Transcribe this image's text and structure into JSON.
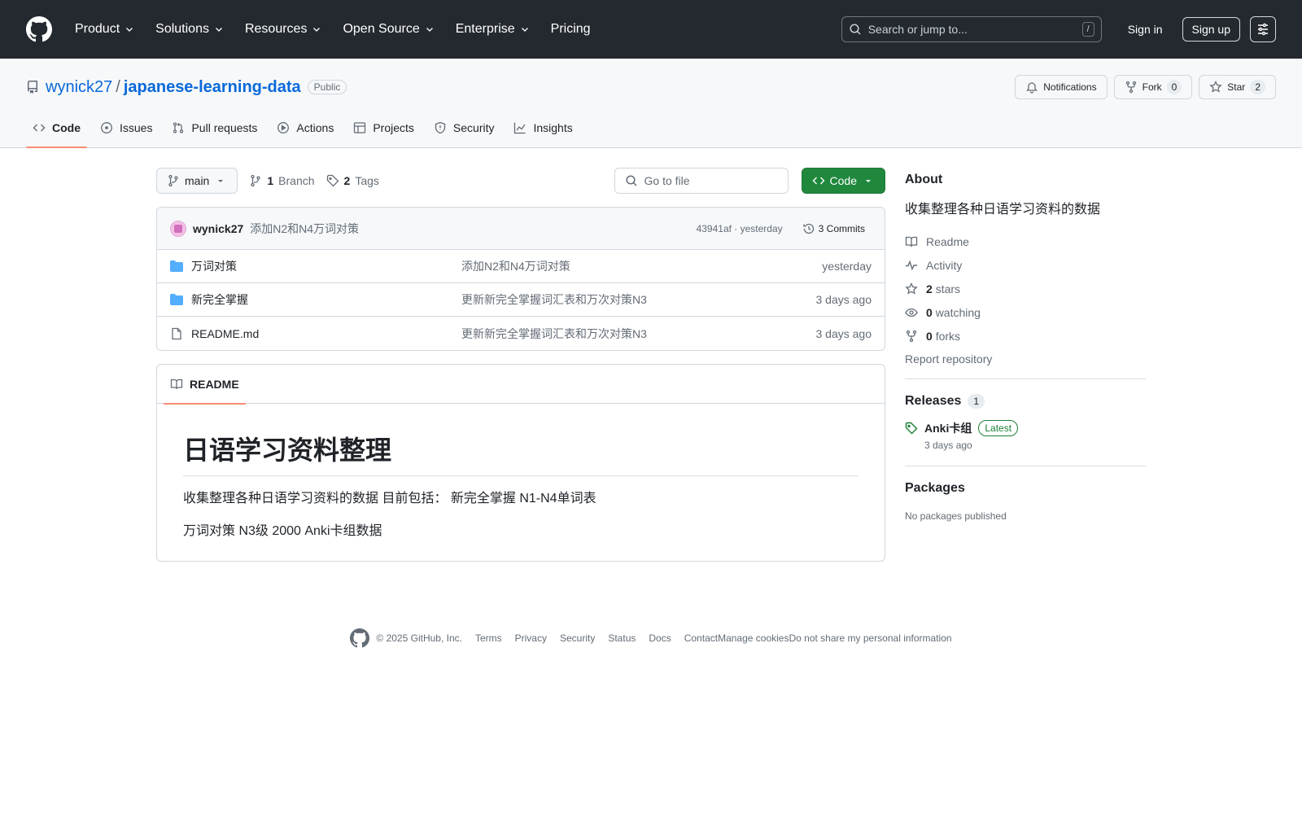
{
  "header": {
    "nav": [
      "Product",
      "Solutions",
      "Resources",
      "Open Source",
      "Enterprise",
      "Pricing"
    ],
    "search_placeholder": "Search or jump to...",
    "search_shortcut": "/",
    "sign_in": "Sign in",
    "sign_up": "Sign up"
  },
  "repo": {
    "owner": "wynick27",
    "separator": "/",
    "name": "japanese-learning-data",
    "visibility": "Public",
    "notifications_label": "Notifications",
    "fork_label": "Fork",
    "fork_count": "0",
    "star_label": "Star",
    "star_count": "2",
    "tabs": [
      "Code",
      "Issues",
      "Pull requests",
      "Actions",
      "Projects",
      "Security",
      "Insights"
    ]
  },
  "toolbar": {
    "branch": "main",
    "branch_count": "1",
    "branch_label": "Branch",
    "tag_count": "2",
    "tag_label": "Tags",
    "goto_placeholder": "Go to file",
    "code_button": "Code"
  },
  "latest_commit": {
    "author": "wynick27",
    "message": "添加N2和N4万词对策",
    "hash_time": "43941af · yesterday",
    "commits_label": "3 Commits"
  },
  "files": [
    {
      "name": "万词对策",
      "type": "folder",
      "commit": "添加N2和N4万词对策",
      "time": "yesterday"
    },
    {
      "name": "新完全掌握",
      "type": "folder",
      "commit": "更新新完全掌握词汇表和万次对策N3",
      "time": "3 days ago"
    },
    {
      "name": "README.md",
      "type": "file",
      "commit": "更新新完全掌握词汇表和万次对策N3",
      "time": "3 days ago"
    }
  ],
  "readme": {
    "tab_label": "README",
    "title": "日语学习资料整理",
    "paragraphs": [
      "收集整理各种日语学习资料的数据 目前包括： 新完全掌握 N1-N4单词表",
      "万词对策 N3级 2000 Anki卡组数据"
    ]
  },
  "about": {
    "title": "About",
    "description": "收集整理各种日语学习资料的数据",
    "readme": "Readme",
    "activity": "Activity",
    "stars_count": "2",
    "stars_label": "stars",
    "watching_count": "0",
    "watching_label": "watching",
    "forks_count": "0",
    "forks_label": "forks",
    "report": "Report repository"
  },
  "releases": {
    "title": "Releases",
    "count": "1",
    "name": "Anki卡组",
    "badge": "Latest",
    "date": "3 days ago"
  },
  "packages": {
    "title": "Packages",
    "empty": "No packages published"
  },
  "footer": {
    "copyright": "© 2025 GitHub, Inc.",
    "links": [
      "Terms",
      "Privacy",
      "Security",
      "Status",
      "Docs",
      "Contact"
    ],
    "tight_links": [
      "Manage cookies",
      "Do not share my personal information"
    ]
  },
  "colors": {
    "header_bg": "#24292f",
    "link": "#0969da",
    "primary_button": "#1f883d",
    "tab_underline": "#fd8c73",
    "folder": "#54aeff"
  }
}
